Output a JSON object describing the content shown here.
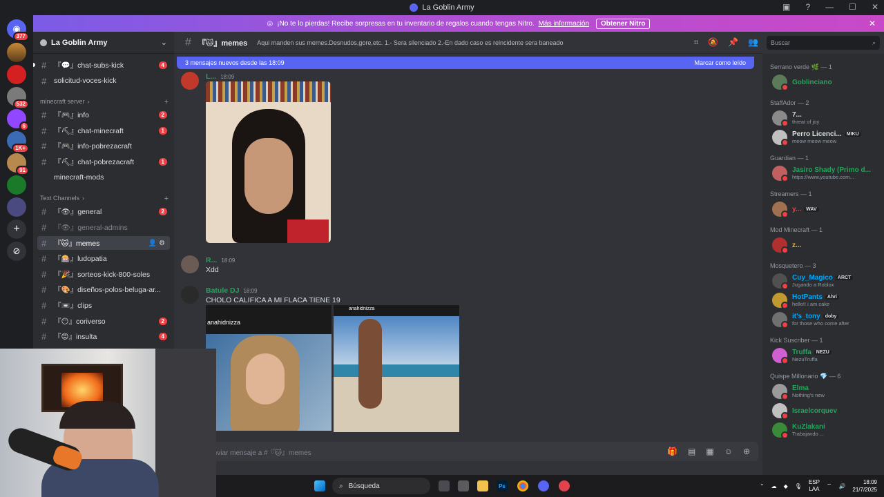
{
  "window": {
    "title": "La Goblin Army"
  },
  "nitro_banner": {
    "text": "¡No te lo pierdas! Recibe sorpresas en tu inventario de regalos cuando tengas Nitro.",
    "link": "Más información",
    "button": "Obtener Nitro"
  },
  "server_badges": [
    "377",
    "532",
    "6",
    "1K+",
    "91"
  ],
  "server": {
    "name": "La Goblin Army"
  },
  "categories": {
    "minecraft": "minecraft server",
    "text": "Text Channels"
  },
  "channels": [
    {
      "name": "『💬』chat-subs-kick",
      "badge": "4"
    },
    {
      "name": "solicitud-voces-kick",
      "badge": ""
    },
    {
      "name": "『🎮』info",
      "badge": "2"
    },
    {
      "name": "『⛏』chat-minecraft",
      "badge": "1"
    },
    {
      "name": "『🎮』info-pobrezacraft",
      "badge": ""
    },
    {
      "name": "『⛏』chat-pobrezacraft",
      "badge": "1"
    },
    {
      "name": "minecraft-mods",
      "badge": ""
    },
    {
      "name": "『👁』general",
      "badge": "2"
    },
    {
      "name": "『👁』general-admins",
      "badge": ""
    },
    {
      "name": "『🐱』memes",
      "badge": ""
    },
    {
      "name": "『🎰』ludopatia",
      "badge": ""
    },
    {
      "name": "『🎉』sorteos-kick-800-soles",
      "badge": ""
    },
    {
      "name": "『🎨』diseños-polos-beluga-ar...",
      "badge": ""
    },
    {
      "name": "『📼』clips",
      "badge": ""
    },
    {
      "name": "『😶』coriverso",
      "badge": "2"
    },
    {
      "name": "『😡』insulta",
      "badge": "4"
    }
  ],
  "channel_header": {
    "name": "『🐱』memes",
    "topic": "Aqui manden sus memes.Desnudos,gore,etc. 1.- Sera silenciado 2.-En dado caso es reincidente sera baneado"
  },
  "search": {
    "placeholder": "Buscar"
  },
  "new_messages": {
    "text": "3 mensajes nuevos desde las 18:09",
    "action": "Marcar como leído"
  },
  "messages": [
    {
      "author": "L...",
      "time": "18:09",
      "text": ""
    },
    {
      "author": "R...",
      "time": "18:09",
      "text": "Xdd"
    },
    {
      "author": "Batule DJ",
      "time": "18:09",
      "text": "CHOLO CALIFICA A MI FLACA TIENE 19"
    }
  ],
  "embed": {
    "handle1": "anahidnizza",
    "handle2": "anahidnizza"
  },
  "composer": {
    "placeholder": "Enviar mensaje a #『🐱』memes"
  },
  "member_groups": [
    {
      "title": "Serrano verde 🌿 — 1",
      "members": [
        {
          "name": "Goblinciano",
          "status": "",
          "tag": "",
          "color": "#23a55a"
        }
      ]
    },
    {
      "title": "StaffAdor — 2",
      "members": [
        {
          "name": "7...",
          "status": "threat of joy",
          "tag": "",
          "color": "#dbdee1"
        },
        {
          "name": "Perro Licenci...",
          "status": "meow meow meow",
          "tag": "MIKU",
          "color": "#dbdee1"
        }
      ]
    },
    {
      "title": "Guardian — 1",
      "members": [
        {
          "name": "Jasiro Shady (Primo d...",
          "status": "https://www.youtube.com...",
          "tag": "",
          "color": "#23a55a"
        }
      ]
    },
    {
      "title": "Streamers — 1",
      "members": [
        {
          "name": "y...",
          "status": "",
          "tag": "WAV",
          "color": "#f23f43"
        }
      ]
    },
    {
      "title": "Mod Minecraft — 1",
      "members": [
        {
          "name": "z...",
          "status": "",
          "tag": "",
          "color": "#f0b232"
        }
      ]
    },
    {
      "title": "Mosquetero — 3",
      "members": [
        {
          "name": "Cuy_Magico",
          "status": "Jugando a Roblox",
          "tag": "ARCT",
          "color": "#00a8fc"
        },
        {
          "name": "HotPants",
          "status": "hello!! i am cake",
          "tag": "Ahri",
          "color": "#00a8fc"
        },
        {
          "name": "it's_tony",
          "status": "for those who come after",
          "tag": "doby",
          "color": "#00a8fc"
        }
      ]
    },
    {
      "title": "Kick Suscriber — 1",
      "members": [
        {
          "name": "Truffa",
          "status": "NezuTruffa",
          "tag": "NEZU",
          "color": "#23a55a"
        }
      ]
    },
    {
      "title": "Quispe Millonario 💎 — 6",
      "members": [
        {
          "name": "Elma",
          "status": "Nothing's new",
          "tag": "",
          "color": "#23a55a"
        },
        {
          "name": "Israelcorquev",
          "status": "",
          "tag": "",
          "color": "#23a55a"
        },
        {
          "name": "KuZlakani",
          "status": "Trabajando ...",
          "tag": "",
          "color": "#23a55a"
        }
      ]
    }
  ],
  "taskbar": {
    "search": "Búsqueda",
    "lang1": "ESP",
    "lang2": "LAA",
    "time": "18:09",
    "date": "21/7/2025"
  }
}
